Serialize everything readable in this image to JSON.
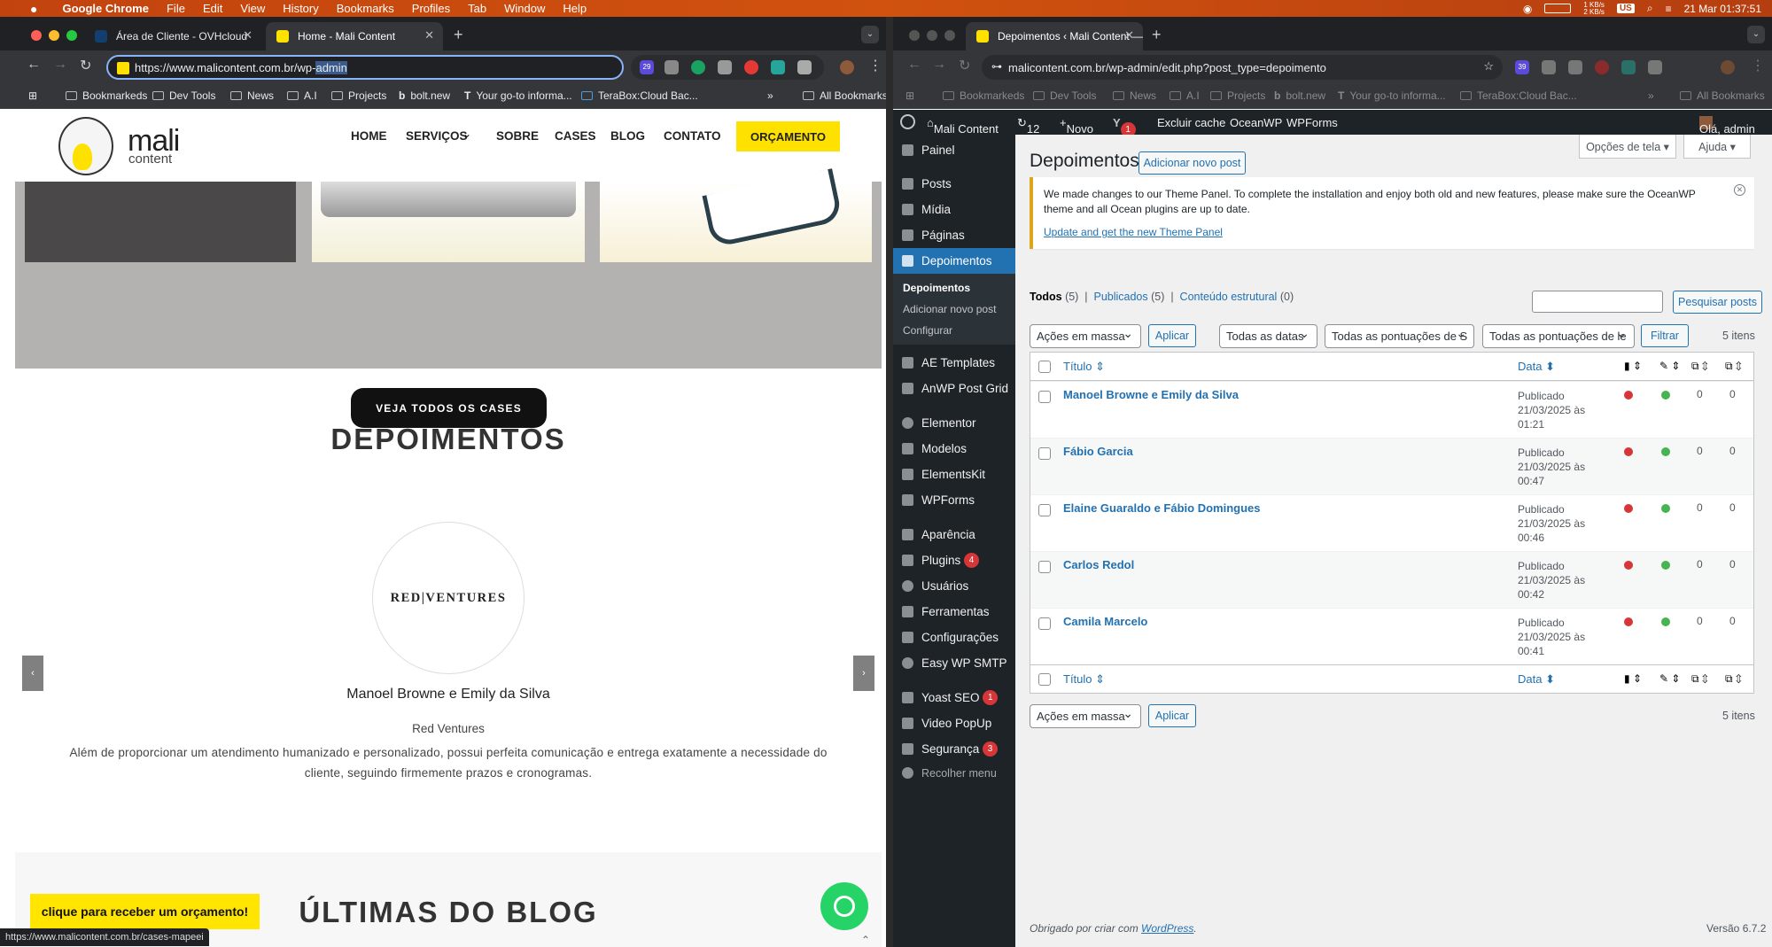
{
  "macbar": {
    "apple": "",
    "app": "Google Chrome",
    "menus": [
      "File",
      "Edit",
      "View",
      "History",
      "Bookmarks",
      "Profiles",
      "Tab",
      "Window",
      "Help"
    ],
    "net": "1 KB/s\n2 KB/s",
    "lang": "US",
    "datetime": "21 Mar  01:37:51"
  },
  "left": {
    "tabs": [
      {
        "title": "Área de Cliente - OVHcloud"
      },
      {
        "title": "Home - Mali Content"
      }
    ],
    "url_prefix": "https://www.malicontent.com.br/wp-",
    "url_selected": "admin",
    "ext_badge": "29",
    "bookmarks": [
      "Bookmarkeds",
      "Dev Tools",
      "News",
      "A.I",
      "Projects",
      "bolt.new",
      "Your go-to informa...",
      "TeraBox:Cloud Bac..."
    ],
    "all_bookmarks": "All Bookmarks",
    "site": {
      "logo_main": "mali",
      "logo_sub": "content",
      "nav": [
        "HOME",
        "SERVIÇOS",
        "SOBRE",
        "CASES",
        "BLOG",
        "CONTATO"
      ],
      "nav_chevron": "⌄",
      "orcamento": "ORÇAMENTO",
      "veja_todos": "VEJA TODOS OS CASES",
      "section_title": "DEPOIMENTOS",
      "client_logo": "RED|VENTURES",
      "testimonial_name": "Manoel Browne e Emily da Silva",
      "testimonial_company": "Red Ventures",
      "testimonial_text": "Além de proporcionar um atendimento humanizado e personalizado, possui perfeita comunicação e entrega exatamente a necessidade do cliente, seguindo firmemente prazos e cronogramas.",
      "prev": "‹",
      "next": "›",
      "blog_title": "ÚLTIMAS DO BLOG",
      "cta": "clique para receber um orçamento!",
      "status_url": "https://www.malicontent.com.br/cases-mapeei"
    }
  },
  "right": {
    "tab_title": "Depoimentos ‹ Mali Content —",
    "url": "malicontent.com.br/wp-admin/edit.php?post_type=depoimento",
    "ext_badge": "39",
    "bookmarks": [
      "Bookmarkeds",
      "Dev Tools",
      "News",
      "A.I",
      "Projects",
      "bolt.new",
      "Your go-to informa...",
      "TeraBox:Cloud Bac..."
    ],
    "all_bookmarks": "All Bookmarks",
    "adminbar": {
      "site": "Mali Content",
      "updates": "12",
      "new": "Novo",
      "yoast_badge": "1",
      "cache": "Excluir cache",
      "ocean": "OceanWP",
      "wpforms": "WPForms",
      "greeting": "Olá, admin"
    },
    "menu": [
      {
        "label": "Painel"
      },
      {
        "label": "Posts"
      },
      {
        "label": "Mídia"
      },
      {
        "label": "Páginas"
      },
      {
        "label": "Depoimentos"
      },
      {
        "label": "AE Templates"
      },
      {
        "label": "AnWP Post Grid"
      },
      {
        "label": "Elementor"
      },
      {
        "label": "Modelos"
      },
      {
        "label": "ElementsKit"
      },
      {
        "label": "WPForms"
      },
      {
        "label": "Aparência"
      },
      {
        "label": "Plugins",
        "badge": "4"
      },
      {
        "label": "Usuários"
      },
      {
        "label": "Ferramentas"
      },
      {
        "label": "Configurações"
      },
      {
        "label": "Easy WP SMTP"
      },
      {
        "label": "Yoast SEO",
        "badge": "1"
      },
      {
        "label": "Video PopUp"
      },
      {
        "label": "Segurança",
        "badge": "3"
      },
      {
        "label": "Recolher menu"
      }
    ],
    "submenu": [
      "Depoimentos",
      "Adicionar novo post",
      "Configurar"
    ],
    "page_title": "Depoimentos",
    "add_new": "Adicionar novo post",
    "screen_options": "Opções de tela ▾",
    "help": "Ajuda ▾",
    "notice_text": "We made changes to our Theme Panel. To complete the installation and enjoy both old and new features, please make sure the OceanWP theme and all Ocean plugins are up to date.",
    "notice_link": "Update and get the new Theme Panel",
    "views": {
      "all": "Todos",
      "all_count": "(5)",
      "pub": "Publicados",
      "pub_count": "(5)",
      "struct": "Conteúdo estrutural",
      "struct_count": "(0)"
    },
    "search_btn": "Pesquisar posts",
    "bulk": "Ações em massa",
    "apply": "Aplicar",
    "dates": "Todas as datas",
    "score1": "Todas as pontuações de S",
    "score2": "Todas as pontuações de le",
    "filter": "Filtrar",
    "items": "5 itens",
    "col_title": "Título",
    "col_date": "Data",
    "rows": [
      {
        "title": "Manoel Browne e Emily da Silva",
        "status": "Publicado",
        "date": "21/03/2025 às",
        "time": "01:21",
        "c1": "0",
        "c2": "0"
      },
      {
        "title": "Fábio Garcia",
        "status": "Publicado",
        "date": "21/03/2025 às",
        "time": "00:47",
        "c1": "0",
        "c2": "0"
      },
      {
        "title": "Elaine Guaraldo e Fábio Domingues",
        "status": "Publicado",
        "date": "21/03/2025 às",
        "time": "00:46",
        "c1": "0",
        "c2": "0"
      },
      {
        "title": "Carlos Redol",
        "status": "Publicado",
        "date": "21/03/2025 às",
        "time": "00:42",
        "c1": "0",
        "c2": "0"
      },
      {
        "title": "Camila Marcelo",
        "status": "Publicado",
        "date": "21/03/2025 às",
        "time": "00:41",
        "c1": "0",
        "c2": "0"
      }
    ],
    "footer_text": "Obrigado por criar com ",
    "footer_link": "WordPress",
    "footer_dot": ".",
    "version": "Versão 6.7.2"
  },
  "colors": {
    "wp_blue": "#2271b1",
    "wp_dark": "#1d2327",
    "yellow": "#ffe100",
    "red_dot": "#d63638",
    "green_dot": "#46b450"
  }
}
